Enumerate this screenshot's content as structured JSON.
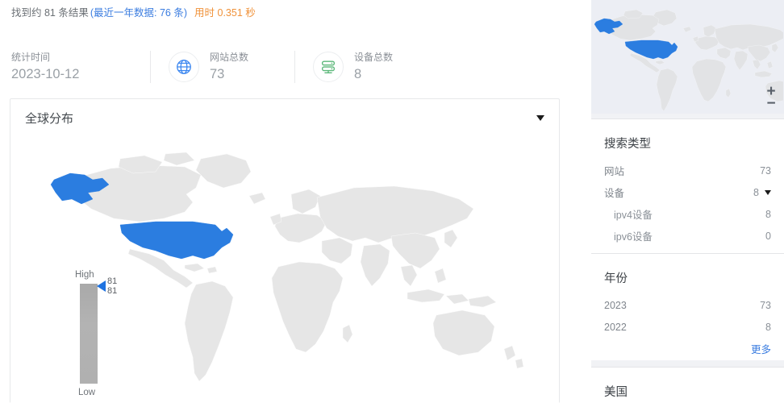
{
  "results": {
    "prefix": "找到约 81 条结果",
    "recent": "(最近一年数据: 76 条)",
    "elapsed": "用时 0.351 秒"
  },
  "stats": [
    {
      "label": "统计时间",
      "value": "2023-10-12",
      "icon": "none"
    },
    {
      "label": "网站总数",
      "value": "73",
      "icon": "globe-icon"
    },
    {
      "label": "设备总数",
      "value": "8",
      "icon": "server-icon"
    }
  ],
  "card": {
    "title": "全球分布",
    "collapse_icon": "caret-down-icon",
    "legend": {
      "high": "High",
      "low": "Low",
      "marker_values": [
        "81",
        "81"
      ]
    }
  },
  "sidebar": {
    "minimap": {
      "zoom_in": "+",
      "zoom_out": "−"
    },
    "panels": [
      {
        "title": "搜索类型",
        "rows": [
          {
            "name": "网站",
            "count": "73",
            "sub": false,
            "caret": false
          },
          {
            "name": "设备",
            "count": "8",
            "sub": false,
            "caret": true
          },
          {
            "name": "ipv4设备",
            "count": "8",
            "sub": true,
            "caret": false
          },
          {
            "name": "ipv6设备",
            "count": "0",
            "sub": true,
            "caret": false
          }
        ]
      },
      {
        "title": "年份",
        "rows": [
          {
            "name": "2023",
            "count": "73",
            "sub": false,
            "caret": false
          },
          {
            "name": "2022",
            "count": "8",
            "sub": false,
            "caret": false
          }
        ],
        "more": "更多"
      },
      {
        "title": "美国",
        "rows": []
      }
    ]
  },
  "colors": {
    "accent_blue": "#3b7de0",
    "highlight_blue": "#2b7de0",
    "orange": "#f0923a",
    "green": "#5cb87a",
    "land_gray": "#e6e6e6"
  }
}
